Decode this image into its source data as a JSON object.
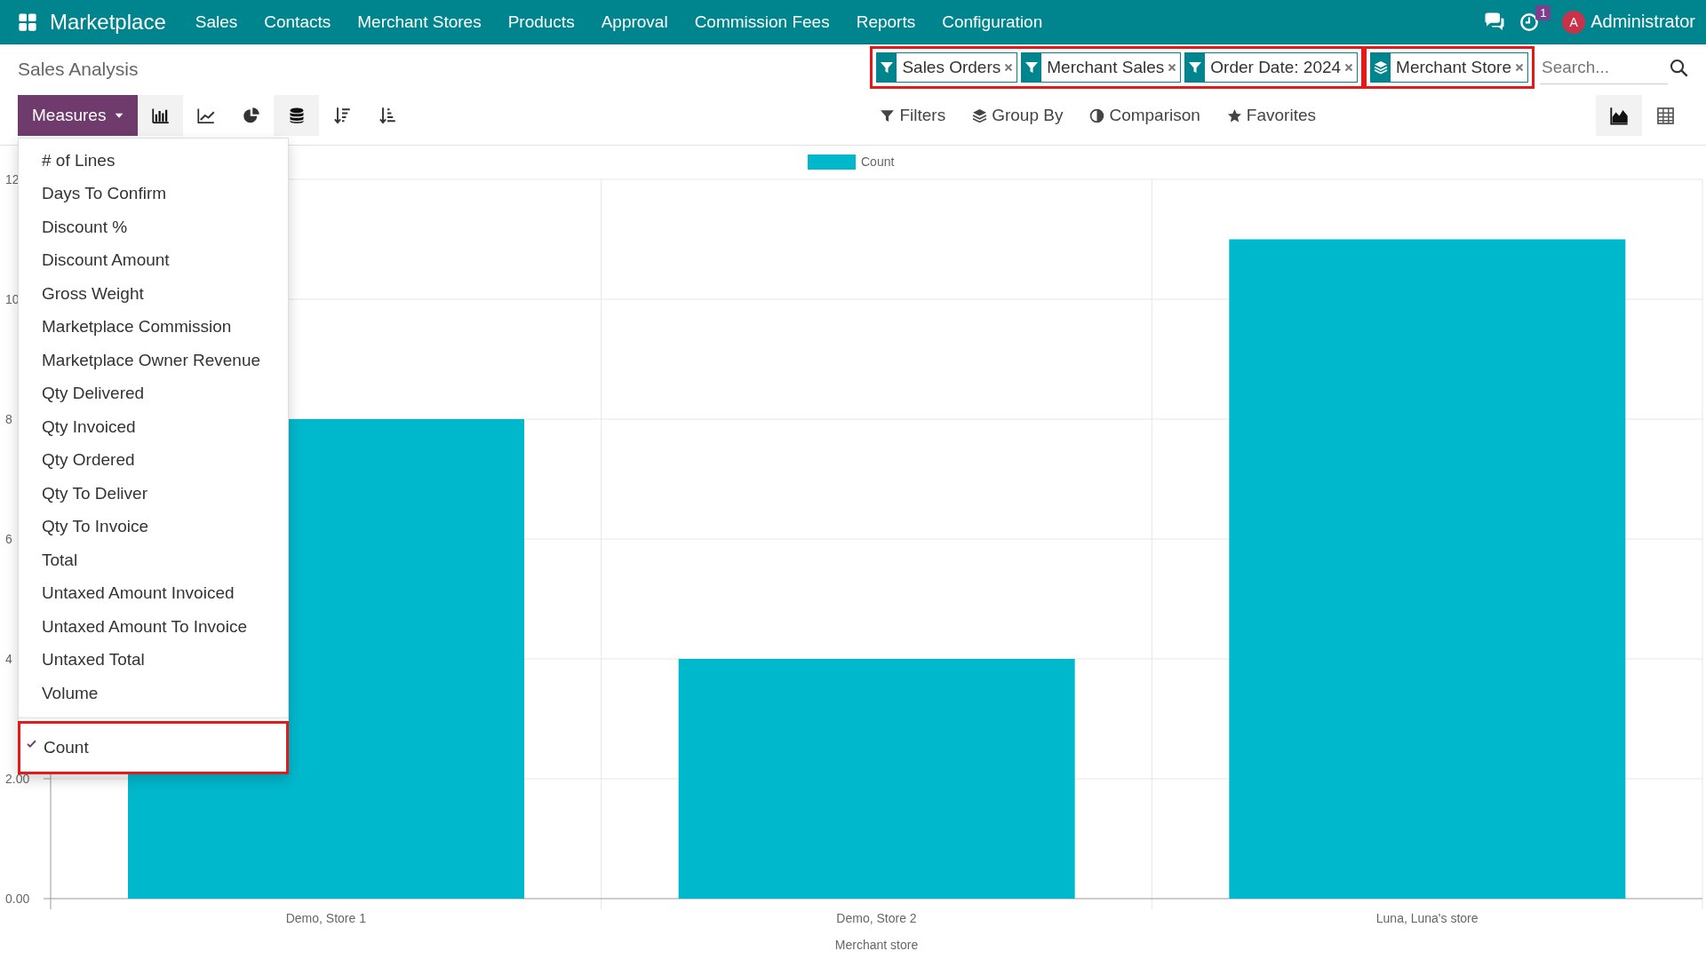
{
  "navbar": {
    "app_name": "Marketplace",
    "menu": [
      "Sales",
      "Contacts",
      "Merchant Stores",
      "Products",
      "Approval",
      "Commission Fees",
      "Reports",
      "Configuration"
    ],
    "activity_badge": "1",
    "user_initial": "A",
    "user_name": "Administrator"
  },
  "control_panel": {
    "title": "Sales Analysis",
    "facet_groups": [
      {
        "highlighted": true,
        "facets": [
          {
            "kind": "filter",
            "label": "Sales Orders"
          },
          {
            "kind": "filter",
            "label": "Merchant Sales"
          },
          {
            "kind": "filter",
            "label": "Order Date: 2024"
          }
        ]
      },
      {
        "highlighted": true,
        "facets": [
          {
            "kind": "groupby",
            "label": "Merchant Store"
          }
        ]
      }
    ],
    "search": {
      "placeholder": "Search..."
    },
    "measures_button": "Measures",
    "chart_buttons": [
      {
        "kind": "bar",
        "selected": true
      },
      {
        "kind": "line",
        "selected": false
      },
      {
        "kind": "pie",
        "selected": false
      },
      {
        "kind": "stacked",
        "selected": true
      },
      {
        "kind": "sort-desc",
        "selected": false
      },
      {
        "kind": "sort-asc",
        "selected": false
      }
    ],
    "search_options": [
      {
        "kind": "filters",
        "label": "Filters"
      },
      {
        "kind": "groupby",
        "label": "Group By"
      },
      {
        "kind": "comparison",
        "label": "Comparison"
      },
      {
        "kind": "favorites",
        "label": "Favorites"
      }
    ],
    "views": [
      {
        "kind": "graph",
        "selected": true
      },
      {
        "kind": "pivot",
        "selected": false
      }
    ]
  },
  "measures_menu": {
    "items": [
      {
        "label": "# of Lines",
        "checked": false
      },
      {
        "label": "Days To Confirm",
        "checked": false
      },
      {
        "label": "Discount %",
        "checked": false
      },
      {
        "label": "Discount Amount",
        "checked": false
      },
      {
        "label": "Gross Weight",
        "checked": false
      },
      {
        "label": "Marketplace Commission",
        "checked": false
      },
      {
        "label": "Marketplace Owner Revenue",
        "checked": false
      },
      {
        "label": "Qty Delivered",
        "checked": false
      },
      {
        "label": "Qty Invoiced",
        "checked": false
      },
      {
        "label": "Qty Ordered",
        "checked": false
      },
      {
        "label": "Qty To Deliver",
        "checked": false
      },
      {
        "label": "Qty To Invoice",
        "checked": false
      },
      {
        "label": "Total",
        "checked": false
      },
      {
        "label": "Untaxed Amount Invoiced",
        "checked": false
      },
      {
        "label": "Untaxed Amount To Invoice",
        "checked": false
      },
      {
        "label": "Untaxed Total",
        "checked": false
      },
      {
        "label": "Volume",
        "checked": false
      }
    ],
    "extra_items": [
      {
        "label": "Count",
        "checked": true,
        "highlighted": true
      }
    ]
  },
  "graph": {
    "chart_data": {
      "type": "bar",
      "xlabel": "Merchant store",
      "categories": [
        "Demo, Store 1",
        "Demo, Store 2",
        "Luna, Luna's store"
      ],
      "series": [
        {
          "name": "Count",
          "color": "#00b8cc",
          "values": [
            8,
            4,
            11
          ]
        }
      ],
      "ylim": [
        0,
        12
      ],
      "grid": true,
      "yticks": [
        {
          "value": 0,
          "label": "0.00"
        },
        {
          "value": 2,
          "label": "2.00"
        },
        {
          "value": 4,
          "label": "4"
        },
        {
          "value": 6,
          "label": "6"
        },
        {
          "value": 8,
          "label": "8"
        },
        {
          "value": 10,
          "label": "10"
        },
        {
          "value": 12,
          "label": "12"
        }
      ]
    }
  }
}
